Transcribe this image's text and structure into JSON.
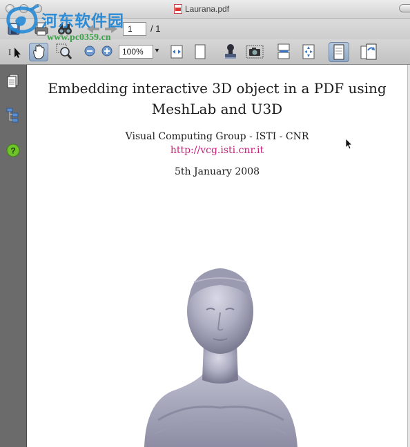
{
  "window": {
    "title": "Laurana.pdf"
  },
  "watermark": {
    "site_name": "河东软件园",
    "site_url": "www.pc0359.cn"
  },
  "toolbar": {
    "page_current": "1",
    "page_total": "/ 1",
    "zoom_value": "100%",
    "icons": [
      "text-select-icon",
      "hand-tool-icon",
      "zoom-tool-icon",
      "zoom-out-icon",
      "zoom-in-icon",
      "fit-width-icon",
      "fit-page-icon",
      "stamp-icon",
      "snapshot-icon",
      "single-page-icon",
      "fullscreen-icon",
      "continuous-page-icon",
      "rotate-icon"
    ]
  },
  "sidebar": {
    "icons": [
      "pages-icon",
      "bookmarks-icon",
      "help-icon"
    ]
  },
  "document": {
    "title_line1": "Embedding interactive 3D object in a PDF using",
    "title_line2": "MeshLab and U3D",
    "author": "Visual Computing Group - ISTI - CNR",
    "link": "http://vcg.isti.cnr.it",
    "date": "5th January 2008"
  },
  "colors": {
    "link": "#c8207a",
    "sidebar_bg": "#6b6b6b",
    "statue": "#b6b6c9",
    "watermark_blue": "#1f86d6",
    "watermark_green": "#3ea24a"
  }
}
